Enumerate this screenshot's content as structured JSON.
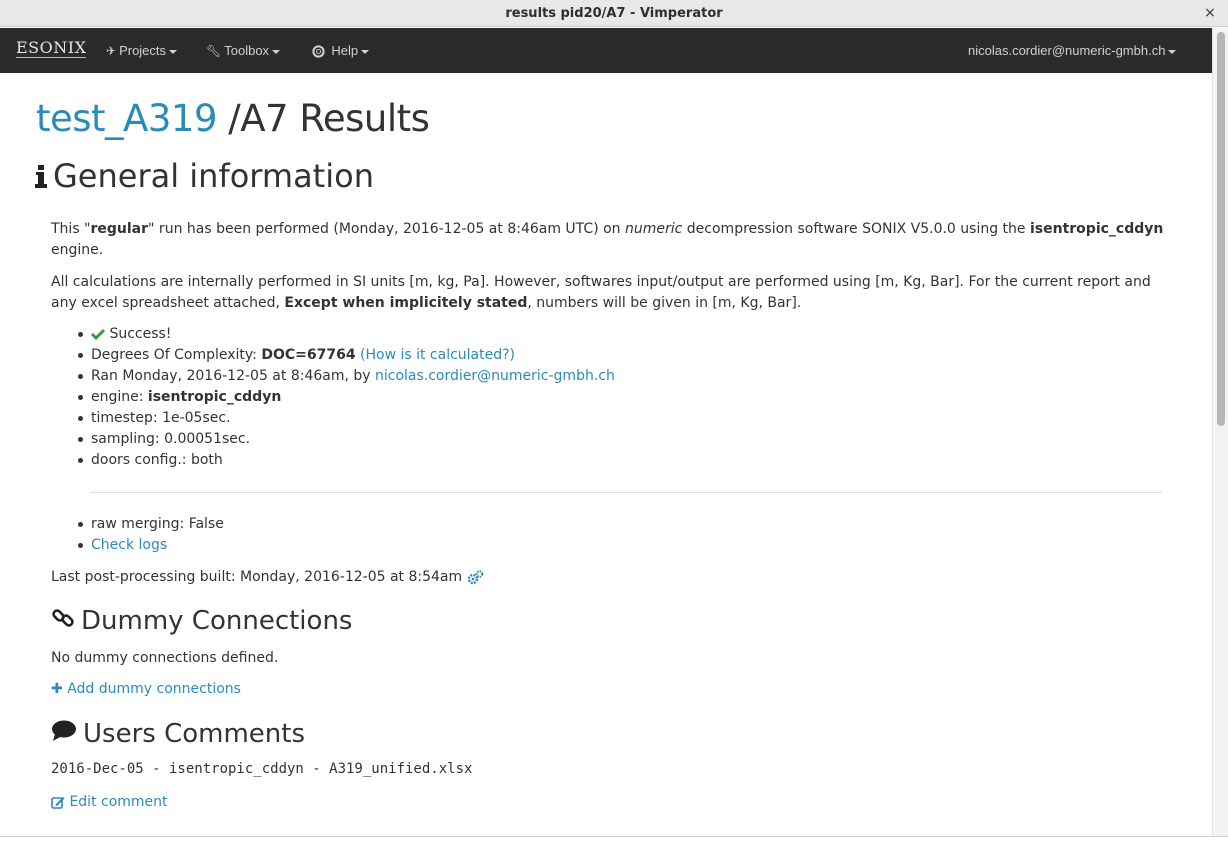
{
  "window": {
    "title": "results pid20/A7 - Vimperator",
    "close_glyph": "×"
  },
  "navbar": {
    "brand": "ESONIX",
    "items": [
      {
        "label": "Projects",
        "icon": "plane-icon"
      },
      {
        "label": "Toolbox",
        "icon": "wrench-icon"
      },
      {
        "label": "Help",
        "icon": "lifebuoy-icon"
      }
    ],
    "user": "nicolas.cordier@numeric-gmbh.ch"
  },
  "page": {
    "title_link": "test_A319",
    "title_rest": " /A7 Results"
  },
  "general": {
    "heading": "General information",
    "p1": {
      "a": "This \"",
      "b": "regular",
      "c": "\" run has been performed (Monday, 2016-12-05 at 8:46am UTC) on ",
      "d": "numeric",
      "e": " decompression software SONIX V5.0.0 using the ",
      "f": "isentropic_cddyn",
      "g": " engine."
    },
    "p2": {
      "a": "All calculations are internally performed in SI units [m, kg, Pa]. However, softwares input/output are performed using [m, Kg, Bar]. For the current report and any excel spreadsheet attached, ",
      "b": "Except when implicitely stated",
      "c": ", numbers will be given in [m, Kg, Bar]."
    },
    "list": {
      "success": "Success!",
      "doc_label": "Degrees Of Complexity: ",
      "doc_value": "DOC=67764",
      "doc_link": "(How is it calculated?)",
      "ran_label": "Ran Monday, 2016-12-05 at 8:46am, by ",
      "ran_user": "nicolas.cordier@numeric-gmbh.ch",
      "engine_label": "engine: ",
      "engine_value": "isentropic_cddyn",
      "timestep": "timestep: 1e-05sec.",
      "sampling": "sampling: 0.00051sec.",
      "doors": "doors config.: both"
    },
    "list2": {
      "raw": "raw merging: False",
      "logs": "Check logs"
    },
    "postproc": "Last post-processing built: Monday, 2016-12-05 at 8:54am"
  },
  "dummy": {
    "heading": "Dummy Connections",
    "none": "No dummy connections defined.",
    "add": "Add dummy connections"
  },
  "comments": {
    "heading": "Users Comments",
    "text": "2016-Dec-05 - isentropic_cddyn - A319_unified.xlsx",
    "edit": "Edit comment"
  },
  "colors": {
    "link": "#2a8ab8",
    "navbar": "#2b2b2b",
    "success": "#3a9a3a"
  }
}
